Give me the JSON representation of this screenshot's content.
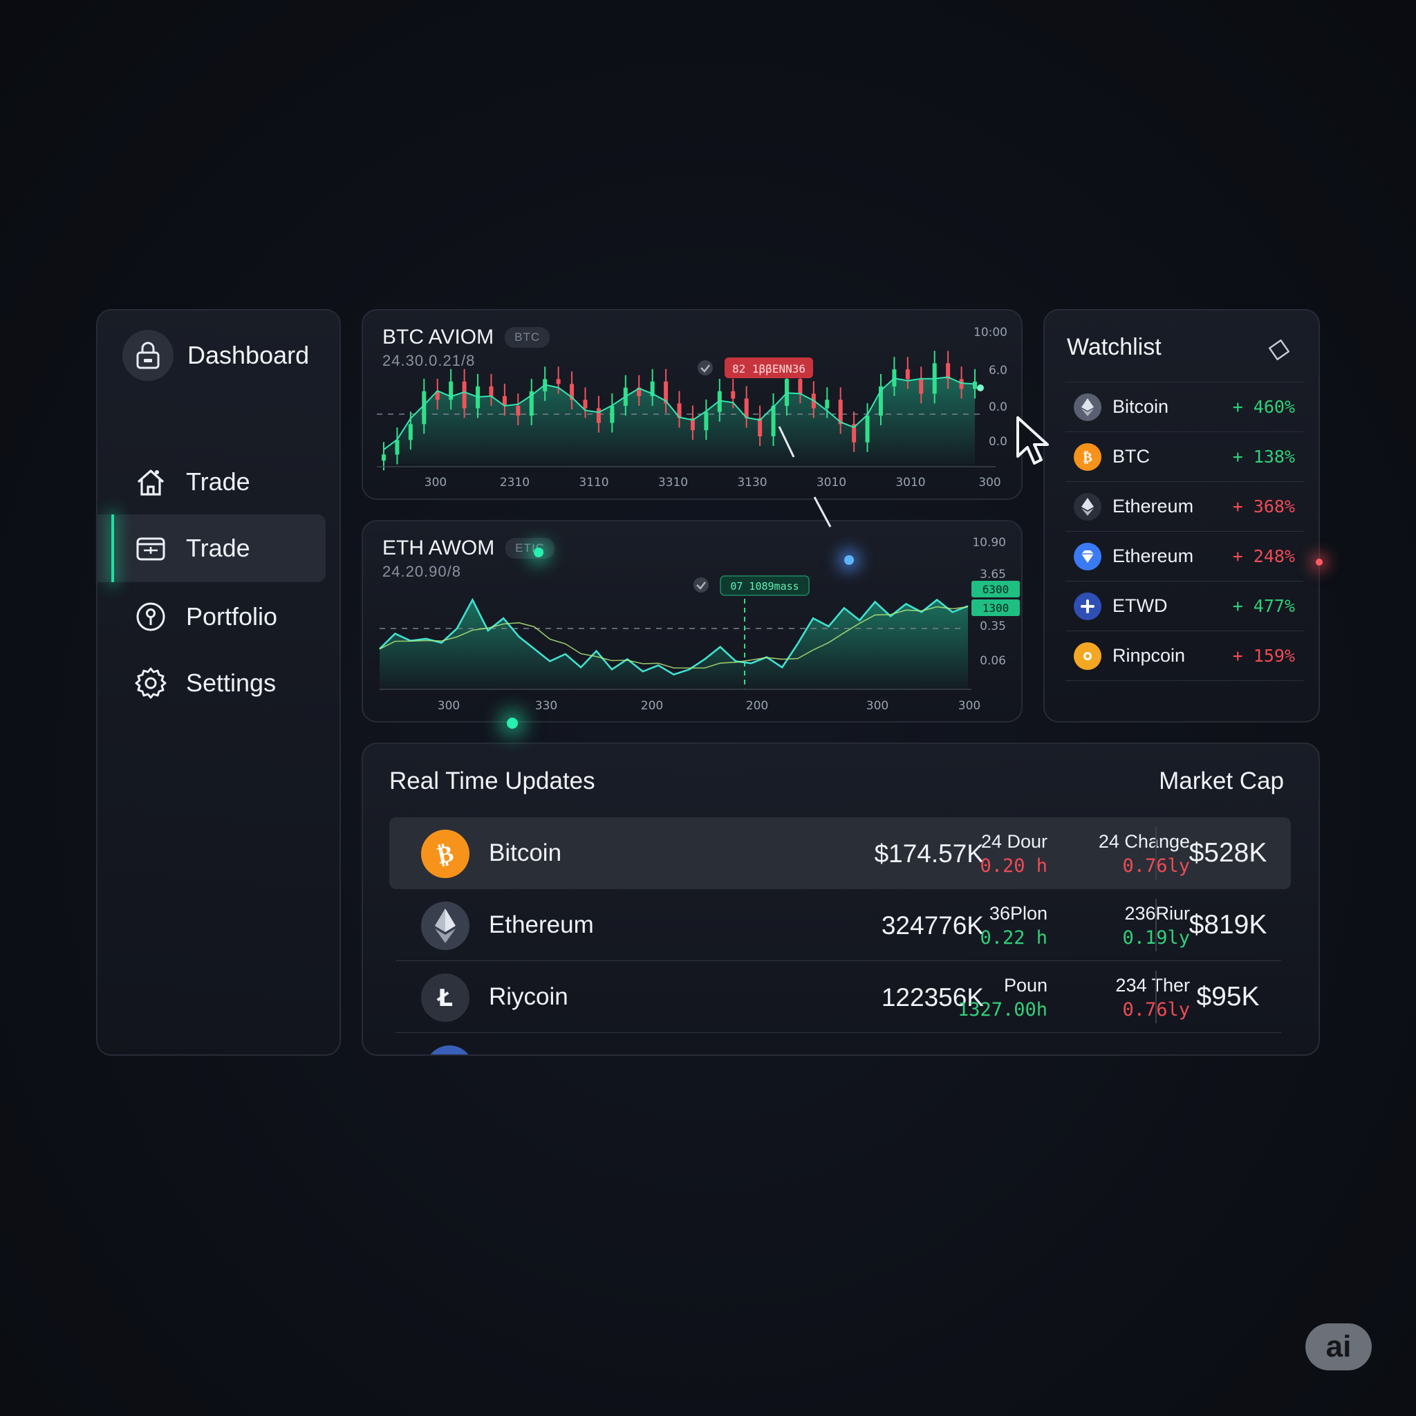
{
  "sidebar": {
    "brand_label": "Dashboard",
    "items": [
      {
        "label": "Trade",
        "icon": "home-icon",
        "active": false
      },
      {
        "label": "Trade",
        "icon": "wallet-icon",
        "active": true
      },
      {
        "label": "Portfolio",
        "icon": "portfolio-icon",
        "active": false
      },
      {
        "label": "Settings",
        "icon": "gear-icon",
        "active": false
      }
    ]
  },
  "btc_chart": {
    "title": "BTC AVIOM",
    "tag": "BTC",
    "subtitle": "24.30.0.21/8",
    "callout": "82 1ββΕΝΝ36",
    "y_ticks": [
      "10:00",
      "6.0",
      "0.0",
      "0.0"
    ],
    "x_ticks": [
      "300",
      "2310",
      "3110",
      "3310",
      "3130",
      "3010",
      "3010",
      "300"
    ]
  },
  "eth_chart": {
    "title": "ETH AWOM",
    "tag": "ETIC",
    "subtitle": "24.20.90/8",
    "callout": "07 1089mass",
    "y_ticks": [
      "10.90",
      "3.65",
      "0.35",
      "0.06"
    ],
    "price_tags": [
      "6300",
      "1300"
    ],
    "x_ticks": [
      "300",
      "330",
      "200",
      "200",
      "300",
      "300"
    ]
  },
  "chart_data": [
    {
      "type": "candlestick",
      "title": "BTC AVIOM",
      "x_ticks": [
        "300",
        "2310",
        "3110",
        "3310",
        "3130",
        "3010",
        "3010",
        "300"
      ],
      "y_ticks": [
        "10:00",
        "6.0",
        "0.0",
        "0.0"
      ],
      "candles_close": [
        0.1,
        0.22,
        0.35,
        0.62,
        0.55,
        0.7,
        0.48,
        0.66,
        0.58,
        0.5,
        0.42,
        0.62,
        0.72,
        0.68,
        0.55,
        0.48,
        0.36,
        0.5,
        0.65,
        0.58,
        0.7,
        0.52,
        0.4,
        0.3,
        0.45,
        0.62,
        0.56,
        0.4,
        0.25,
        0.5,
        0.72,
        0.6,
        0.48,
        0.55,
        0.35,
        0.2,
        0.42,
        0.66,
        0.8,
        0.72,
        0.6,
        0.85,
        0.72,
        0.64,
        0.7
      ]
    },
    {
      "type": "area",
      "title": "ETH AWOM",
      "x_ticks": [
        "300",
        "330",
        "200",
        "200",
        "300",
        "300"
      ],
      "y_ticks": [
        "10.90",
        "3.65",
        "0.35",
        "0.06"
      ],
      "values": [
        0.3,
        0.45,
        0.38,
        0.4,
        0.36,
        0.5,
        0.78,
        0.48,
        0.6,
        0.42,
        0.3,
        0.18,
        0.25,
        0.12,
        0.28,
        0.1,
        0.2,
        0.08,
        0.14,
        0.05,
        0.1,
        0.2,
        0.32,
        0.18,
        0.16,
        0.22,
        0.12,
        0.35,
        0.6,
        0.52,
        0.7,
        0.58,
        0.76,
        0.62,
        0.74,
        0.66,
        0.78,
        0.66,
        0.72
      ]
    }
  ],
  "watchlist": {
    "title": "Watchlist",
    "items": [
      {
        "name": "Bitcoin",
        "change": "+ 460%",
        "dir": "up",
        "icon": "ethereum-icon",
        "color": "#5a6070"
      },
      {
        "name": "BTC",
        "change": "+ 138%",
        "dir": "up",
        "icon": "bitcoin-icon",
        "color": "#f7931a"
      },
      {
        "name": "Ethereum",
        "change": "+ 368%",
        "dir": "down",
        "icon": "ethereum-icon",
        "color": "#2a2f3a"
      },
      {
        "name": "Ethereum",
        "change": "+ 248%",
        "dir": "down",
        "icon": "diamond-icon",
        "color": "#3a7bf5"
      },
      {
        "name": "ETWD",
        "change": "+ 477%",
        "dir": "up",
        "icon": "plus-icon",
        "color": "#2f4fb5"
      },
      {
        "name": "Rinpcoin",
        "change": "+ 159%",
        "dir": "down",
        "icon": "coin-icon",
        "color": "#f5a623"
      }
    ]
  },
  "updates": {
    "title": "Real Time Updates",
    "market_cap_label": "Market Cap",
    "rows": [
      {
        "name": "Bitcoin",
        "price": "$174.57K",
        "stat1_label": "24 Dour",
        "stat1_value": "0.20 h",
        "stat1_dir": "down",
        "stat2_label": "24 Change",
        "stat2_value": "0.76ly",
        "stat2_dir": "down",
        "mcap": "$528K",
        "icon": "bitcoin-icon",
        "color": "#f7931a"
      },
      {
        "name": "Ethereum",
        "price": "324776K",
        "stat1_label": "36Plon",
        "stat1_value": "0.22 h",
        "stat1_dir": "up",
        "stat2_label": "236Riur",
        "stat2_value": "0.19ly",
        "stat2_dir": "up",
        "mcap": "$819K",
        "icon": "ethereum-icon",
        "color": "#3a3f4d"
      },
      {
        "name": "Riycoin",
        "price": "122356K",
        "stat1_label": "Poun",
        "stat1_value": "1327.00h",
        "stat1_dir": "up",
        "stat2_label": "234 Ther",
        "stat2_value": "0.76ly",
        "stat2_dir": "down",
        "mcap": "$95K",
        "icon": "litecoin-icon",
        "color": "#2e323c"
      }
    ]
  },
  "badge": "ai",
  "colors": {
    "up": "#2fd17a",
    "down": "#ef4b55",
    "accent": "#20e0a0",
    "line": "#3ee0c8"
  }
}
